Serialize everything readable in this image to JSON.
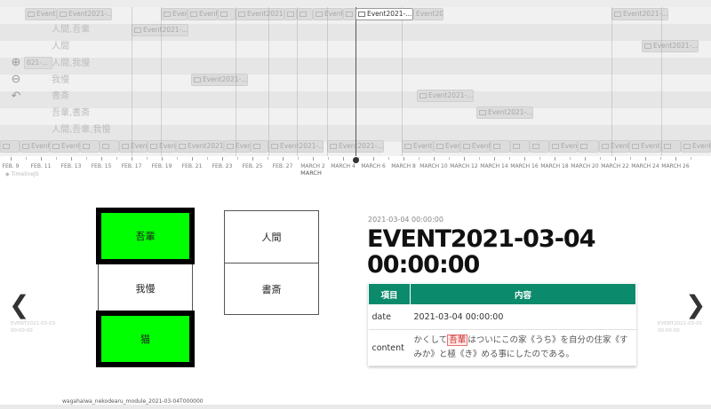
{
  "timeline": {
    "rows": [
      "人間,吾輩",
      "人間",
      "人間,我慢",
      "我慢",
      "書斎",
      "吾輩,書斎",
      "人間,吾輩,我慢"
    ],
    "event_label": "Event2021-...",
    "event_label_short": "Event",
    "active_event_label": "Event2021-...",
    "left_fragment": "021-...",
    "ticks": [
      "FEB. 9",
      "FEB. 11",
      "FEB. 13",
      "FEB. 15",
      "FEB. 17",
      "FEB. 19",
      "FEB. 21",
      "FEB. 23",
      "FEB. 25",
      "FEB. 27",
      "MARCH 2",
      "MARCH 4",
      "MARCH 6",
      "MARCH 8",
      "MARCH 10",
      "MARCH 12",
      "MARCH 14",
      "MARCH 16",
      "MARCH 18",
      "MARCH 20",
      "MARCH 22",
      "MARCH 24",
      "MARCH 26"
    ],
    "month": "MARCH",
    "brand": "◆ TimelineJS"
  },
  "slide": {
    "prev_arrow": "❮",
    "next_arrow": "❯",
    "prev_caption_1": "EVENT2021-03-03",
    "prev_caption_2": "00:00:00",
    "next_caption_1": "EVENT2021-03-05",
    "next_caption_2": "00:00:00",
    "cells": {
      "wagahai": "吾輩",
      "gaman": "我慢",
      "neko": "猫",
      "ningen": "人間",
      "shosai": "書斎"
    },
    "date": "2021-03-04 00:00:00",
    "title_line1": "EVENT2021-03-04",
    "title_line2": "00:00:00",
    "table": {
      "header_key": "項目",
      "header_value": "内容",
      "row1_key": "date",
      "row1_value": "2021-03-04 00:00:00",
      "row2_key": "content",
      "content_before": "かくして",
      "content_highlight": "吾輩",
      "content_after": "はついにこの家《うち》を自分の住家《すみか》と極《き》める事にしたのである。"
    },
    "caption": "wagahaiwa_nekodearu_module_2021-03-04T000000"
  },
  "colors": {
    "accent": "#0b8a6c",
    "green_cell": "#00ff00",
    "highlight_border": "#e57373"
  }
}
